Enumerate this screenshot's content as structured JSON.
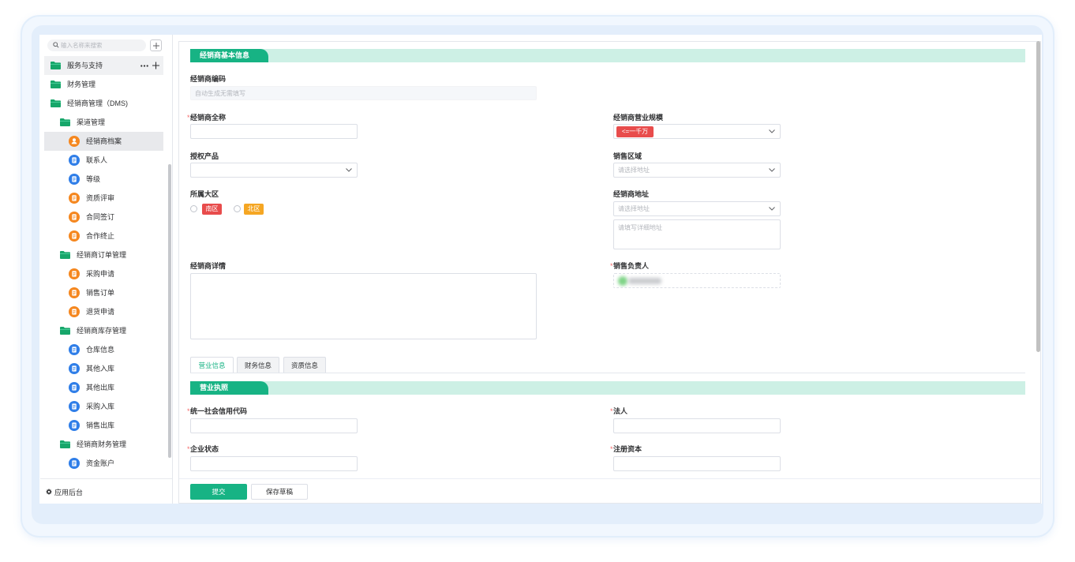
{
  "colors": {
    "accent": "#17b384",
    "accent_light": "#cdf0e5",
    "folder": "#17a66a",
    "orange": "#f5871f",
    "blue": "#2f7ee8",
    "tag_red": "#e84c4c",
    "tag_orange": "#f5a623",
    "required": "#f56c6c"
  },
  "sidebar": {
    "search": {
      "placeholder": "输入名称来搜索",
      "icon": "search-icon"
    },
    "add_button": {
      "icon": "plus-icon"
    },
    "tree": [
      {
        "label": "服务与支持",
        "icon": "folder-icon",
        "level": 0,
        "hovered": true,
        "actions": [
          "more-icon",
          "plus-icon"
        ]
      },
      {
        "label": "财务管理",
        "icon": "folder-icon",
        "level": 0
      },
      {
        "label": "经销商管理（DMS)",
        "icon": "folder-icon",
        "level": 0
      },
      {
        "label": "渠道管理",
        "icon": "folder-icon",
        "level": 1
      },
      {
        "label": "经销商档案",
        "icon": "user-icon",
        "color": "orange",
        "level": 2,
        "selected": true
      },
      {
        "label": "联系人",
        "icon": "document-icon",
        "color": "blue",
        "level": 2
      },
      {
        "label": "等级",
        "icon": "document-icon",
        "color": "blue",
        "level": 2
      },
      {
        "label": "资质评审",
        "icon": "document-icon",
        "color": "orange",
        "level": 2
      },
      {
        "label": "合同签订",
        "icon": "document-icon",
        "color": "orange",
        "level": 2
      },
      {
        "label": "合作终止",
        "icon": "document-icon",
        "color": "orange",
        "level": 2
      },
      {
        "label": "经销商订单管理",
        "icon": "folder-icon",
        "level": 1
      },
      {
        "label": "采购申请",
        "icon": "document-icon",
        "color": "orange",
        "level": 2
      },
      {
        "label": "销售订单",
        "icon": "document-icon",
        "color": "orange",
        "level": 2
      },
      {
        "label": "退货申请",
        "icon": "document-icon",
        "color": "orange",
        "level": 2
      },
      {
        "label": "经销商库存管理",
        "icon": "folder-icon",
        "level": 1
      },
      {
        "label": "仓库信息",
        "icon": "document-icon",
        "color": "blue",
        "level": 2
      },
      {
        "label": "其他入库",
        "icon": "document-icon",
        "color": "blue",
        "level": 2
      },
      {
        "label": "其他出库",
        "icon": "document-icon",
        "color": "blue",
        "level": 2
      },
      {
        "label": "采购入库",
        "icon": "document-icon",
        "color": "blue",
        "level": 2
      },
      {
        "label": "销售出库",
        "icon": "document-icon",
        "color": "blue",
        "level": 2
      },
      {
        "label": "经销商财务管理",
        "icon": "folder-icon",
        "level": 1
      },
      {
        "label": "资金账户",
        "icon": "document-icon",
        "color": "blue",
        "level": 2
      }
    ],
    "footer": {
      "label": "应用后台",
      "icon": "gear-icon"
    }
  },
  "form": {
    "section_basic": {
      "title": "经销商基本信息"
    },
    "dealer_code": {
      "label": "经销商编码",
      "placeholder": "自动生成无需填写",
      "disabled": true
    },
    "dealer_name": {
      "label": "经销商全称",
      "required": true
    },
    "business_scale": {
      "label": "经销商营业规模",
      "selected": "<=一千万",
      "icon": "chevron-down-icon"
    },
    "authorized_product": {
      "label": "授权产品",
      "icon": "chevron-down-icon"
    },
    "sales_area": {
      "label": "销售区域",
      "placeholder": "请选择地址",
      "icon": "chevron-down-icon"
    },
    "region": {
      "label": "所属大区",
      "options": [
        {
          "label": "南区",
          "checked": false
        },
        {
          "label": "北区",
          "checked": false
        }
      ]
    },
    "address": {
      "label": "经销商地址",
      "select_placeholder": "请选择地址",
      "detail_placeholder": "请填写详细地址"
    },
    "details": {
      "label": "经销商详情"
    },
    "sales_owner": {
      "label": "销售负责人",
      "required": true
    },
    "tabs": [
      {
        "label": "营业信息",
        "active": true
      },
      {
        "label": "财务信息",
        "active": false
      },
      {
        "label": "资质信息",
        "active": false
      }
    ],
    "section_license": {
      "title": "营业执照"
    },
    "credit_code": {
      "label": "统一社会信用代码",
      "required": true
    },
    "legal_person": {
      "label": "法人",
      "required": true
    },
    "company_status": {
      "label": "企业状态",
      "required": true
    },
    "registered_capital": {
      "label": "注册资本",
      "required": true
    }
  },
  "actions": {
    "submit": "提交",
    "save_draft": "保存草稿"
  }
}
